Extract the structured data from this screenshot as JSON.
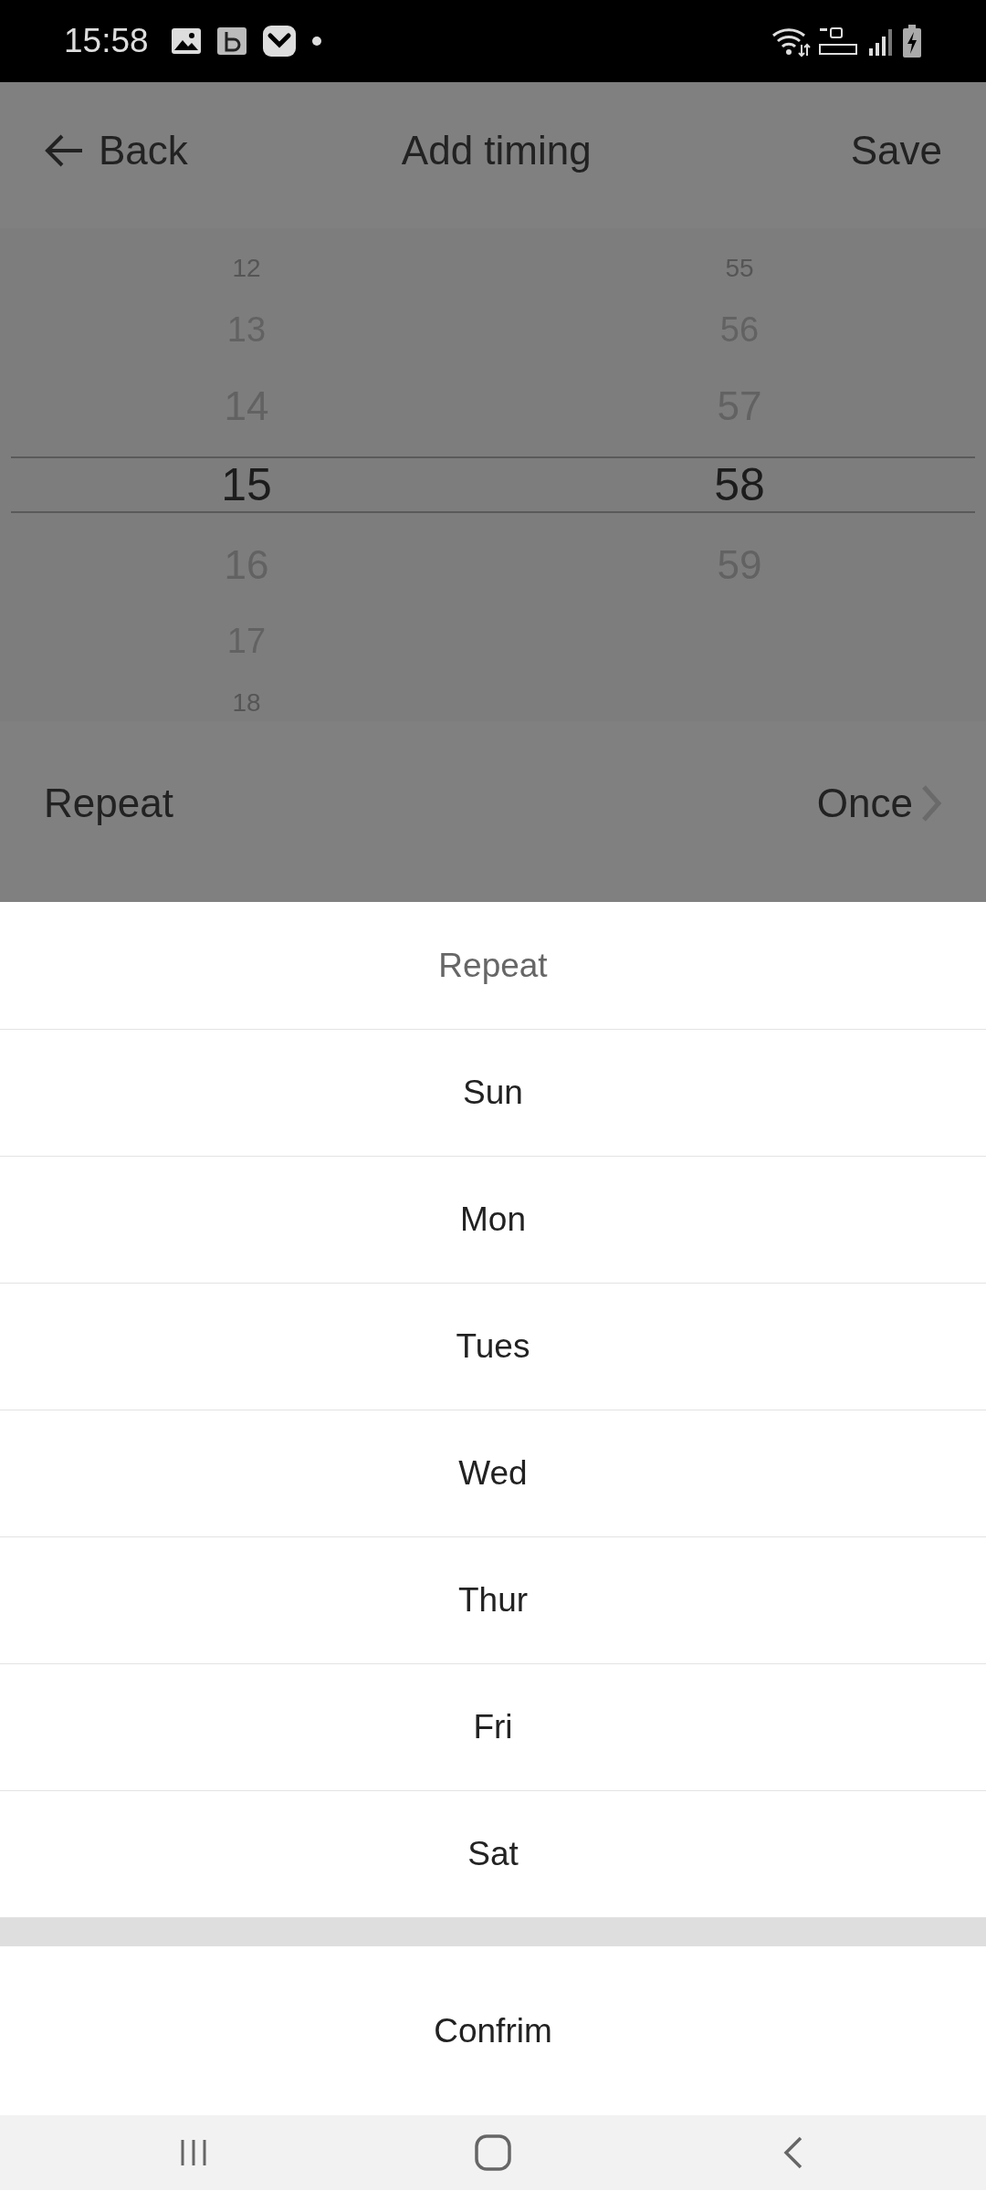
{
  "status_bar": {
    "time": "15:58"
  },
  "header": {
    "back": "Back",
    "title": "Add timing",
    "save": "Save"
  },
  "picker": {
    "columns": [
      {
        "items": [
          {
            "text": "12",
            "selected": false
          },
          {
            "text": "13",
            "selected": false
          },
          {
            "text": "14",
            "selected": false
          },
          {
            "text": "15",
            "selected": true
          },
          {
            "text": "16",
            "selected": false
          },
          {
            "text": "17",
            "selected": false
          },
          {
            "text": "18",
            "selected": false
          }
        ]
      },
      {
        "items": [
          {
            "text": "55",
            "selected": false
          },
          {
            "text": "56",
            "selected": false
          },
          {
            "text": "57",
            "selected": false
          },
          {
            "text": "58",
            "selected": true
          },
          {
            "text": "59",
            "selected": false
          }
        ]
      }
    ]
  },
  "repeat_row": {
    "label": "Repeat",
    "value": "Once"
  },
  "sheet": {
    "title": "Repeat",
    "options": [
      {
        "label": "Sun"
      },
      {
        "label": "Mon"
      },
      {
        "label": "Tues"
      },
      {
        "label": "Wed"
      },
      {
        "label": "Thur"
      },
      {
        "label": "Fri"
      },
      {
        "label": "Sat"
      }
    ],
    "confirm": "Confrim"
  }
}
